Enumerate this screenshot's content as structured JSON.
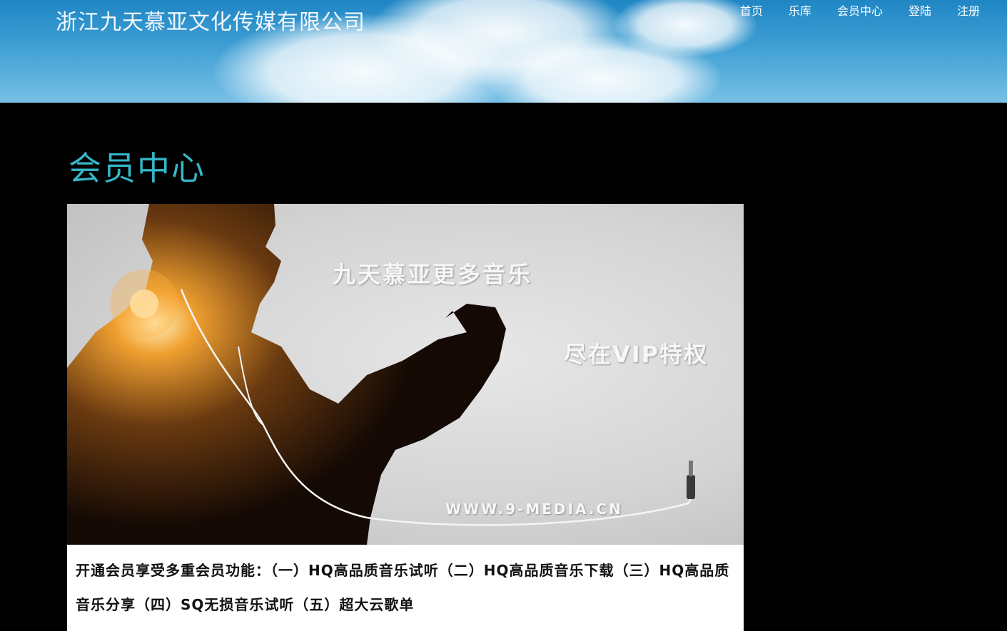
{
  "header": {
    "site_title": "浙江九天慕亚文化传媒有限公司"
  },
  "nav": {
    "items": [
      {
        "label": "首页"
      },
      {
        "label": "乐库"
      },
      {
        "label": "会员中心"
      },
      {
        "label": "登陆"
      },
      {
        "label": "注册"
      }
    ]
  },
  "main": {
    "page_title": "会员中心",
    "banner": {
      "line1": "九天慕亚更多音乐",
      "line2": "尽在VIP特权",
      "url": "WWW.9-MEDIA.CN"
    },
    "features_text": "开通会员享受多重会员功能：（一）HQ高品质音乐试听（二）HQ高品质音乐下载（三）HQ高品质音乐分享（四）SQ无损音乐试听（五）超大云歌单"
  },
  "colors": {
    "page_background": "#000000",
    "title_accent": "#36b6c8",
    "sky_blue": "#3f9fd4"
  }
}
